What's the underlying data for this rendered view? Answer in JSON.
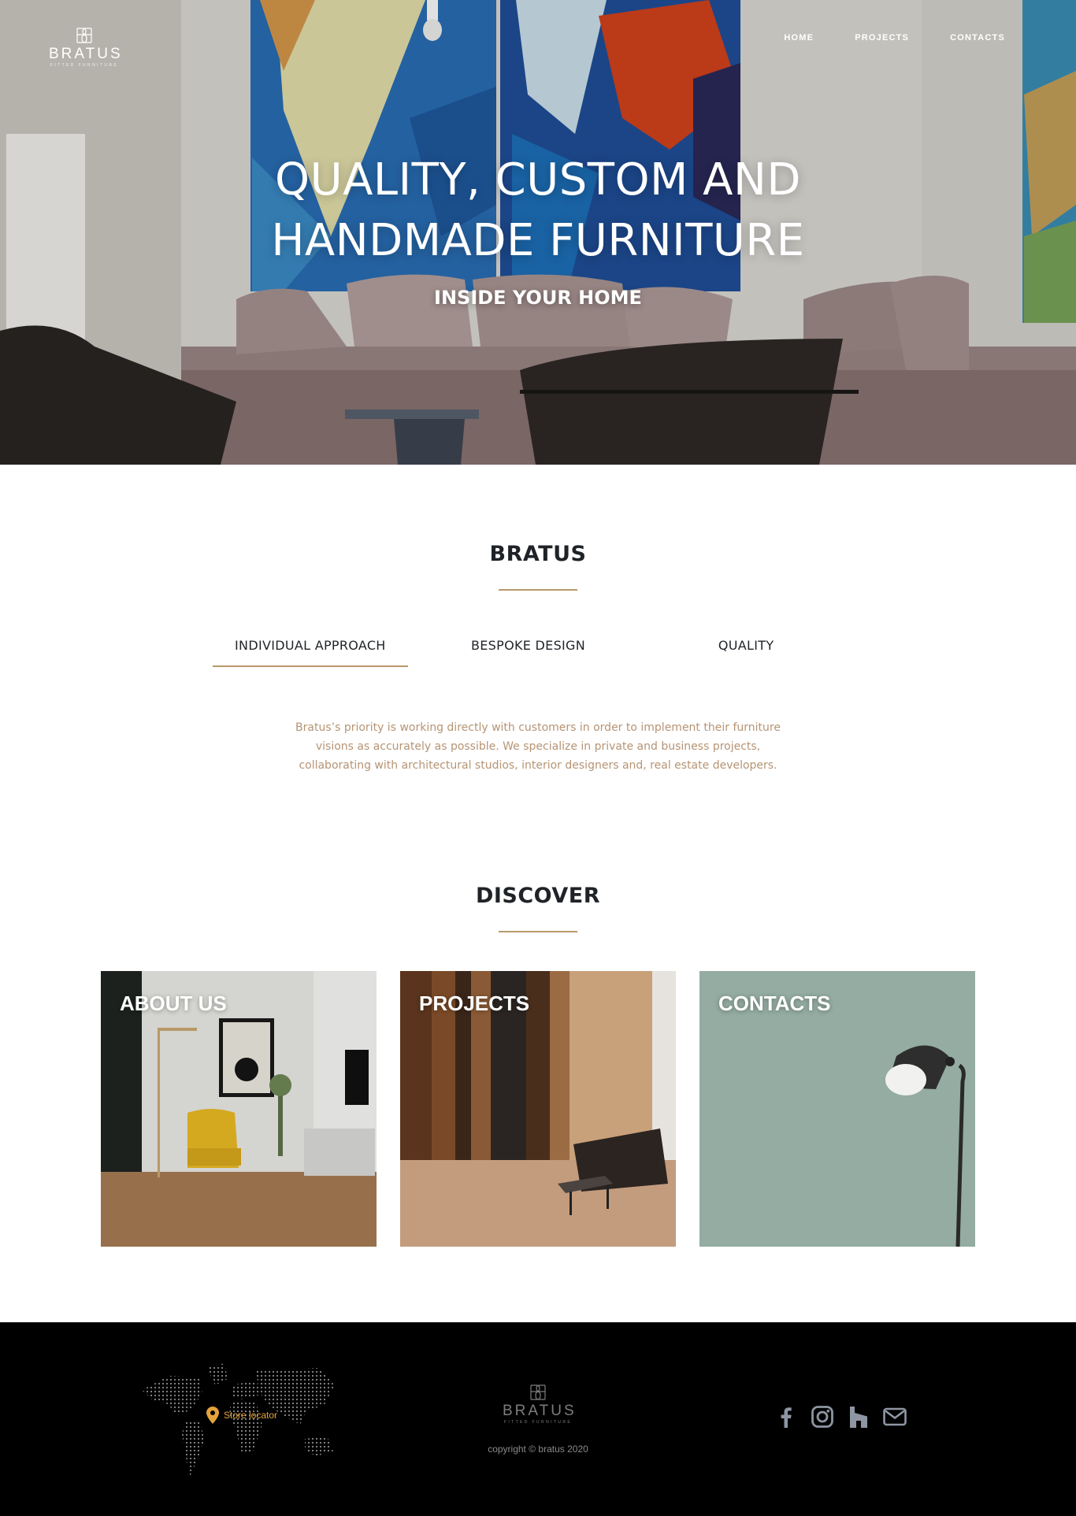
{
  "brand": {
    "name": "BRATUS",
    "tagline": "FITTED FURNITURE"
  },
  "nav": {
    "items": [
      {
        "label": "HOME"
      },
      {
        "label": "PROJECTS"
      },
      {
        "label": "CONTACTS"
      }
    ]
  },
  "hero": {
    "title_line1": "QUALITY, CUSTOM AND",
    "title_line2": "HANDMADE FURNITURE",
    "subtitle": "INSIDE YOUR HOME"
  },
  "about": {
    "title": "BRATUS",
    "tabs": [
      {
        "label": "INDIVIDUAL APPROACH",
        "active": true
      },
      {
        "label": "BESPOKE DESIGN",
        "active": false
      },
      {
        "label": "QUALITY",
        "active": false
      }
    ],
    "text": "Bratus’s priority is working directly with customers in order to implement their furniture visions as accurately as possible. We specialize in private and business projects, collaborating with architectural studios, interior designers and, real estate developers."
  },
  "discover": {
    "title": "DISCOVER",
    "cards": [
      {
        "label": "ABOUT US"
      },
      {
        "label": "PROJECTS"
      },
      {
        "label": "CONTACTS"
      }
    ]
  },
  "footer": {
    "store_locator": "Store locator",
    "copyright": "copyright © bratus 2020",
    "social": [
      {
        "icon": "facebook-icon"
      },
      {
        "icon": "instagram-icon"
      },
      {
        "icon": "houzz-icon"
      },
      {
        "icon": "mail-icon"
      }
    ]
  },
  "colors": {
    "accent": "#b89a6a",
    "body_text": "#b69474",
    "store_locator": "#e4a43a",
    "footer_bg": "#000000",
    "contacts_card": "#8fa89d"
  }
}
